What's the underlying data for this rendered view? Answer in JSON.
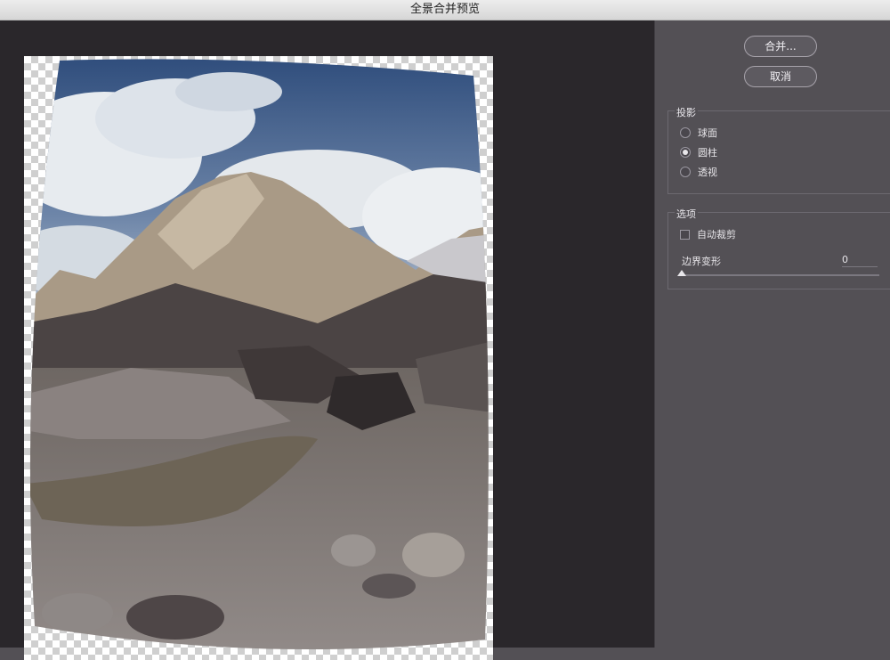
{
  "window": {
    "title": "全景合并预览"
  },
  "buttons": {
    "merge": "合并...",
    "cancel": "取消"
  },
  "projection": {
    "title": "投影",
    "options": [
      {
        "label": "球面",
        "selected": false
      },
      {
        "label": "圆柱",
        "selected": true
      },
      {
        "label": "透视",
        "selected": false
      }
    ]
  },
  "options": {
    "title": "选项",
    "auto_crop": {
      "label": "自动裁剪",
      "checked": false
    },
    "boundary_warp": {
      "label": "边界变形",
      "value": "0"
    }
  }
}
